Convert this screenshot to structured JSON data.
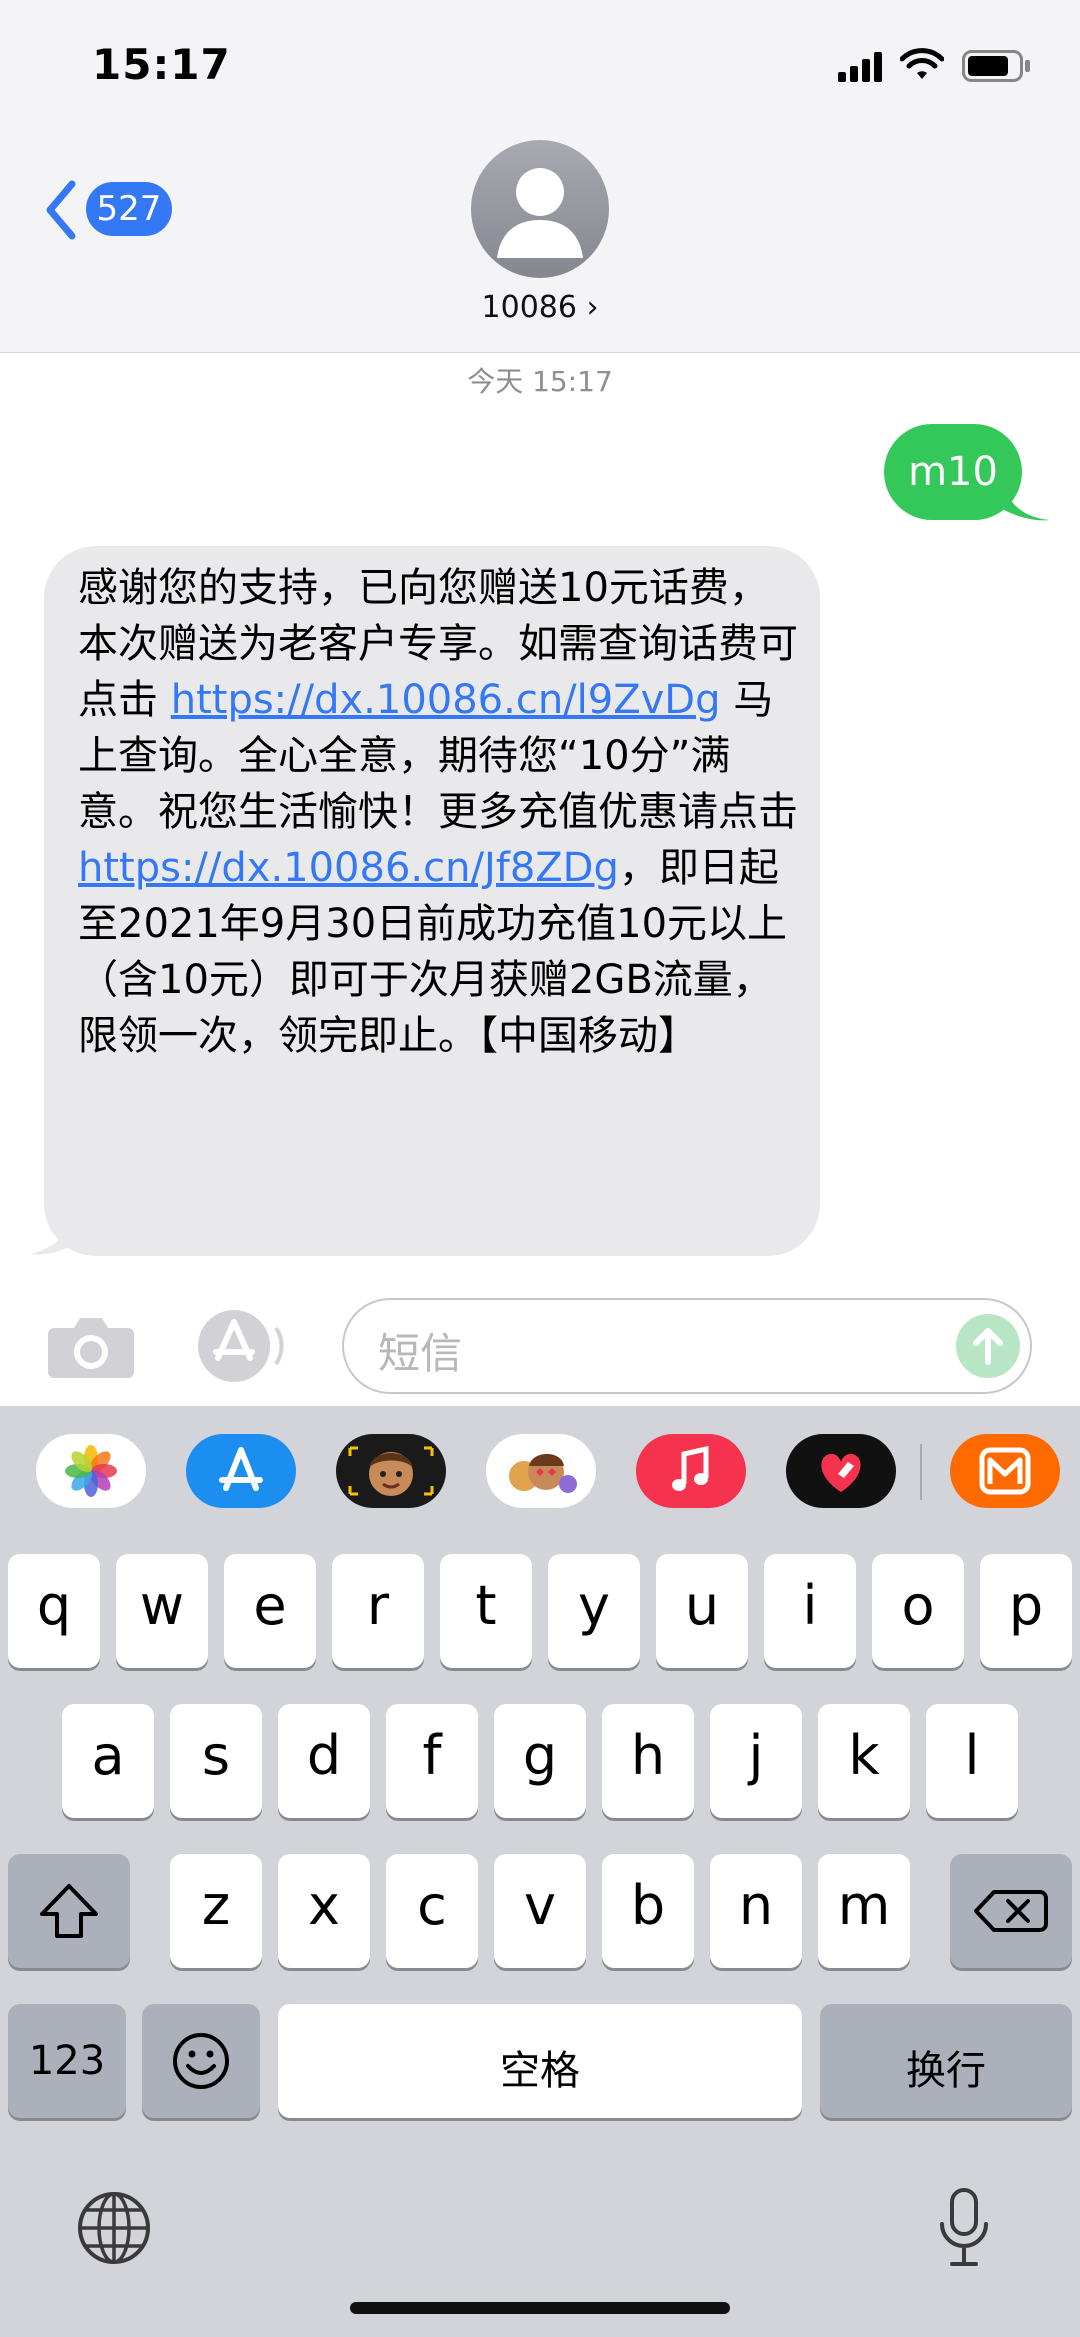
{
  "status_bar": {
    "time": "15:17"
  },
  "header": {
    "back_count": "527",
    "contact_name": "10086 ›"
  },
  "conversation": {
    "timestamp": "今天 15:17",
    "sent_message": "m10",
    "received_message": {
      "seg1": "感谢您的支持，已向您赠送10元话费，本次赠送为老客户专享。如需查询话费可点击 ",
      "link1": "https://dx.10086.cn/l9ZvDg",
      "seg2": " 马上查询。全心全意，期待您“10分”满意。祝您生活愉快！更多充值优惠请点击 ",
      "link2": "https://dx.10086.cn/Jf8ZDg",
      "seg3": "，即日起至2021年9月30日前成功充值10元以上（含10元）即可于次月获赠2GB流量，限领一次，领完即止。【中国移动】"
    }
  },
  "input": {
    "placeholder": "短信"
  },
  "app_strip": {
    "apps": [
      {
        "name": "photos-app-icon"
      },
      {
        "name": "app-store-icon"
      },
      {
        "name": "memoji-icon"
      },
      {
        "name": "animoji-stickers-icon"
      },
      {
        "name": "music-app-icon"
      },
      {
        "name": "digital-touch-icon"
      },
      {
        "name": "mango-tv-icon"
      }
    ]
  },
  "keyboard": {
    "row1": [
      "q",
      "w",
      "e",
      "r",
      "t",
      "y",
      "u",
      "i",
      "o",
      "p"
    ],
    "row2": [
      "a",
      "s",
      "d",
      "f",
      "g",
      "h",
      "j",
      "k",
      "l"
    ],
    "row3": [
      "z",
      "x",
      "c",
      "v",
      "b",
      "n",
      "m"
    ],
    "numbers_key": "123",
    "space_key": "空格",
    "return_key": "换行"
  },
  "colors": {
    "ios_blue": "#3478f6",
    "sent_green": "#34c759",
    "received_gray": "#e9e9eb",
    "keyboard_bg": "#d2d4da"
  }
}
